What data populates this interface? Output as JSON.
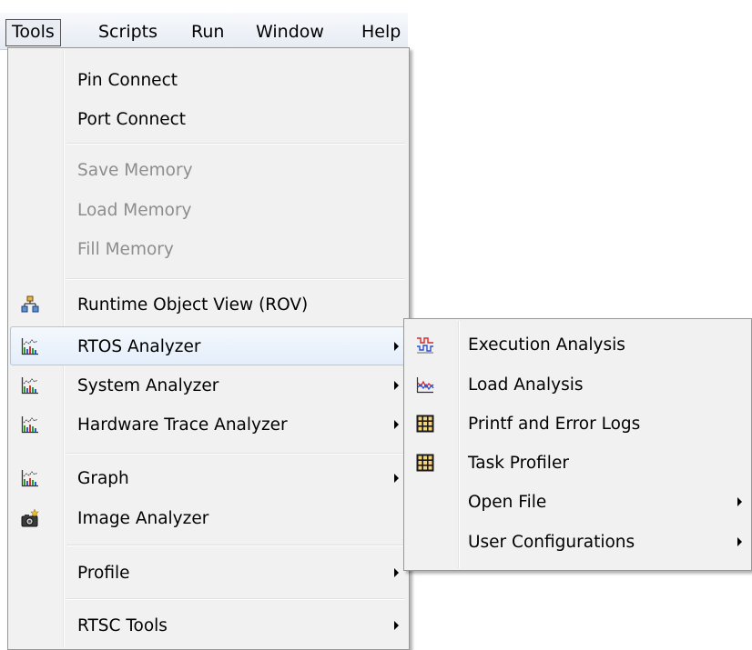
{
  "menubar": {
    "items": [
      {
        "label": "Tools"
      },
      {
        "label": "Scripts"
      },
      {
        "label": "Run"
      },
      {
        "label": "Window"
      },
      {
        "label": "Help"
      }
    ]
  },
  "tools_menu": {
    "items": [
      {
        "label": "Pin Connect"
      },
      {
        "label": "Port Connect"
      },
      {
        "label": "Save Memory"
      },
      {
        "label": "Load Memory"
      },
      {
        "label": "Fill Memory"
      },
      {
        "label": "Runtime Object View (ROV)"
      },
      {
        "label": "RTOS Analyzer"
      },
      {
        "label": "System Analyzer"
      },
      {
        "label": "Hardware Trace Analyzer"
      },
      {
        "label": "Graph"
      },
      {
        "label": "Image Analyzer"
      },
      {
        "label": "Profile"
      },
      {
        "label": "RTSC Tools"
      }
    ]
  },
  "rtos_submenu": {
    "items": [
      {
        "label": "Execution Analysis"
      },
      {
        "label": "Load Analysis"
      },
      {
        "label": "Printf and Error Logs"
      },
      {
        "label": "Task Profiler"
      },
      {
        "label": "Open File"
      },
      {
        "label": "User Configurations"
      }
    ]
  },
  "colors": {
    "menu_bg": "#f1f1f1",
    "hover_bg": "#e4eefb",
    "hover_border": "#a8c8ec",
    "disabled_text": "#8d8d8d"
  }
}
